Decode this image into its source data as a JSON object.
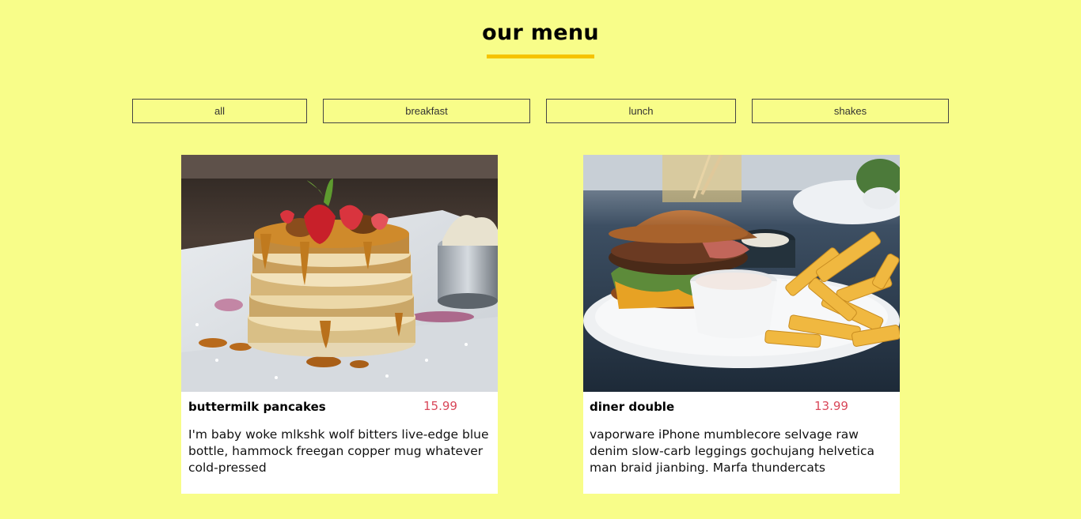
{
  "header": {
    "title": "our menu",
    "accent_color": "#f6c300"
  },
  "filters": [
    {
      "label": "all"
    },
    {
      "label": "breakfast"
    },
    {
      "label": "lunch"
    },
    {
      "label": "shakes"
    }
  ],
  "menu_items": [
    {
      "name": "buttermilk pancakes",
      "price": "15.99",
      "description": "I'm baby woke mlkshk wolf bitters live-edge blue bottle, hammock freegan copper mug whatever cold-pressed",
      "image_icon": "pancakes-photo"
    },
    {
      "name": "diner double",
      "price": "13.99",
      "description": "vaporware iPhone mumblecore selvage raw denim slow-carb leggings gochujang helvetica man braid jianbing. Marfa thundercats",
      "image_icon": "burger-photo"
    }
  ],
  "colors": {
    "background": "#f8fd89",
    "price": "#d9485a",
    "card": "#ffffff"
  }
}
